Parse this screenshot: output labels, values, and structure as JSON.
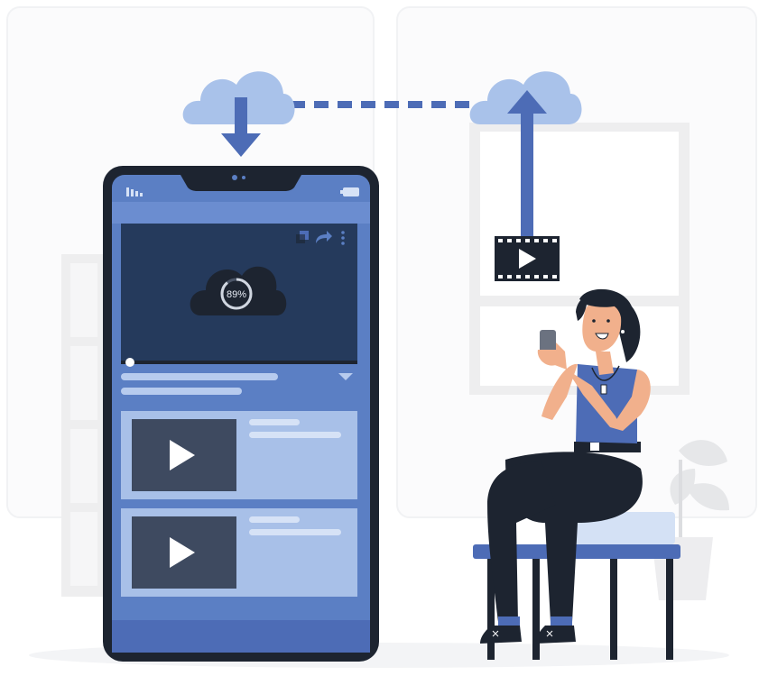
{
  "upload": {
    "progress_label": "89%",
    "progress_fraction": 0.89
  },
  "colors": {
    "accent": "#5b7fc4",
    "accent_dark": "#3f5f9e",
    "cloud": "#a9c2ea",
    "screen_dark": "#253a5c",
    "panel": "#a8c0e8",
    "thumb": "#3e4a60",
    "outline": "#1d2430"
  },
  "icons": [
    "cloud-download-icon",
    "cloud-upload-icon",
    "play-icon",
    "share-icon",
    "more-vert-icon",
    "cast-icon",
    "signal-icon",
    "battery-icon",
    "film-icon"
  ]
}
